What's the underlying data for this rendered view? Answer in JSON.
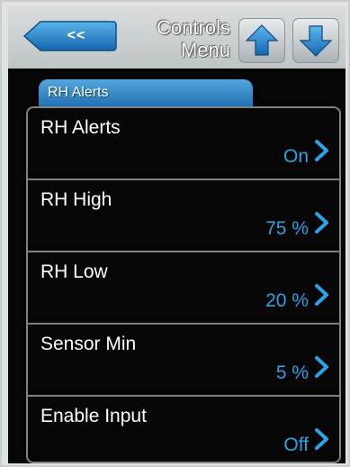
{
  "header": {
    "back_label": "<<",
    "title_line1": "Controls",
    "title_line2": "Menu",
    "up_icon": "arrow-up-icon",
    "down_icon": "arrow-down-icon"
  },
  "tab": {
    "label": "RH Alerts"
  },
  "items": [
    {
      "label": "RH Alerts",
      "value": "On"
    },
    {
      "label": "RH High",
      "value": "75 %"
    },
    {
      "label": "RH Low",
      "value": "20 %"
    },
    {
      "label": "Sensor Min",
      "value": "5 %"
    },
    {
      "label": "Enable Input",
      "value": "Off"
    }
  ],
  "colors": {
    "accent": "#2aa3e6",
    "tab": "#2f86c8",
    "button": "#1f77bf",
    "background": "#050505"
  }
}
